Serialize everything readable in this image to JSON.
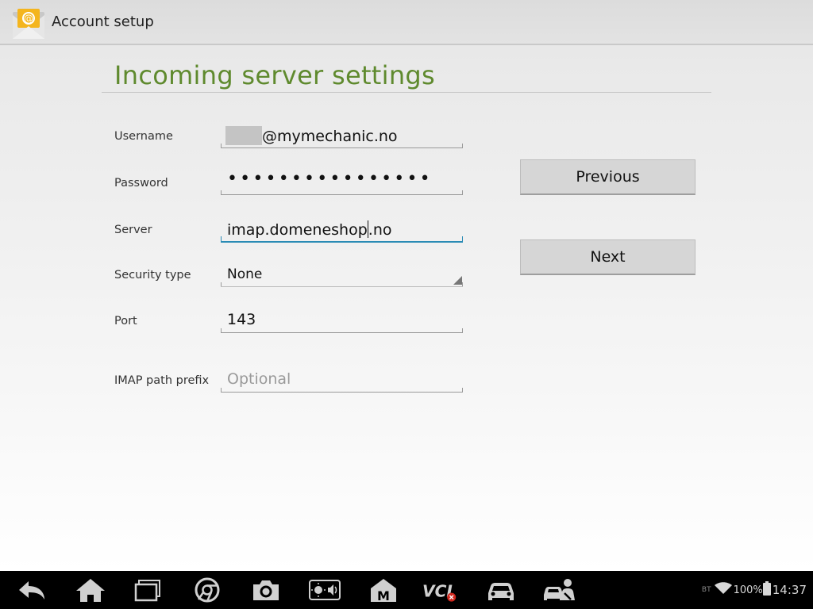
{
  "action_bar": {
    "title": "Account setup",
    "icon": "email-at-icon"
  },
  "heading": "Incoming server settings",
  "form": {
    "username": {
      "label": "Username",
      "value_suffix": "@mymechanic.no"
    },
    "password": {
      "label": "Password",
      "masked_value": "••••••••••••••••"
    },
    "server": {
      "label": "Server",
      "value_before_cursor": "imap.domeneshop",
      "value_after_cursor": ".no"
    },
    "security_type": {
      "label": "Security type",
      "value": "None"
    },
    "port": {
      "label": "Port",
      "value": "143"
    },
    "imap_prefix": {
      "label": "IMAP path prefix",
      "placeholder": "Optional"
    }
  },
  "buttons": {
    "previous": "Previous",
    "next": "Next"
  },
  "nav_bar": {
    "icons": [
      "back-icon",
      "home-icon",
      "recent-apps-icon",
      "chrome-icon",
      "camera-icon",
      "brightness-volume-icon",
      "autel-home-icon",
      "vci-icon",
      "car-icon",
      "car-service-icon"
    ]
  },
  "status_bar": {
    "bt": "BT",
    "battery": "100%",
    "time": "14:37"
  },
  "colors": {
    "heading": "#5f8a2e",
    "focus": "#2a8bb5",
    "button": "#d6d6d6"
  }
}
